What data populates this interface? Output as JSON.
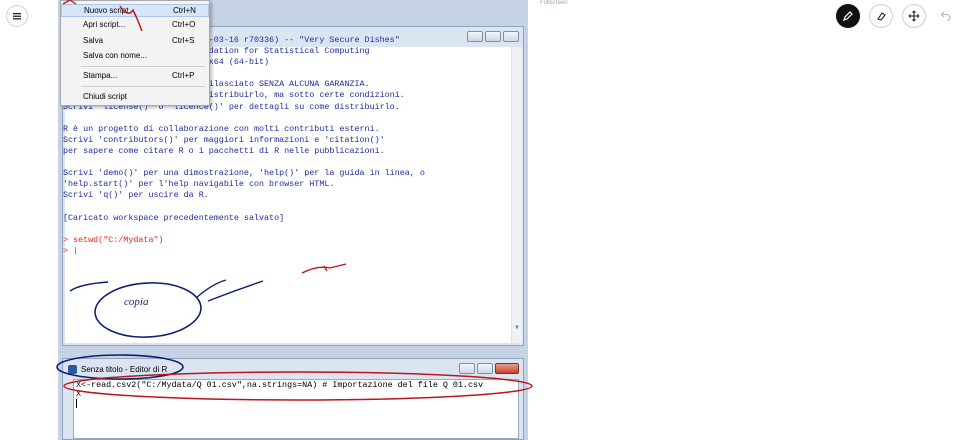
{
  "toolbar": {
    "menu_icon": "hamburger-icon",
    "tools": [
      "pen-icon",
      "eraser-icon",
      "move-icon",
      "undo-icon"
    ]
  },
  "rgui": {
    "fullscreen_label": "Fullscreen",
    "file_menu": [
      {
        "label": "Nuovo script",
        "shortcut": "Ctrl+N"
      },
      {
        "label": "Apri script...",
        "shortcut": "Ctrl+O"
      },
      {
        "label": "Salva",
        "shortcut": "Ctrl+S"
      },
      {
        "label": "Salva con nome...",
        "shortcut": ""
      },
      {
        "label": "Stampa...",
        "shortcut": "Ctrl+P"
      },
      {
        "label": "Chiudi script",
        "shortcut": ""
      }
    ],
    "console": {
      "lines": [
        "                          016-03-16 r70336) -- \"Very Secure Dishes\"",
        "                          oundation for Statistical Computing",
        "                          32/x64 (64-bit)",
        "",
        "R è un software libero ed è rilasciato SENZA ALCUNA GARANZIA.",
        "Siamo ben lieti se potrai redistribuirlo, ma sotto certe condizioni.",
        "Scrivi 'license()' o 'licence()' per dettagli su come distribuirlo.",
        "",
        "R è un progetto di collaborazione con molti contributi esterni.",
        "Scrivi 'contributors()' per maggiori informazioni e 'citation()'",
        "per sapere come citare R o i pacchetti di R nelle pubblicazioni.",
        "",
        "Scrivi 'demo()' per una dimostrazione, 'help()' per la guida in linea, o",
        "'help.start()' per l'help navigabile con browser HTML.",
        "Scrivi 'q()' per uscire da R.",
        "",
        "[Caricato workspace precedentemente salvato]",
        ""
      ],
      "command": "> setwd(\"C:/Mydata\")",
      "prompt": "> |"
    },
    "editor": {
      "title": "Senza titolo - Editor di R",
      "line1": "X<-read.csv2(\"C:/Mydata/Q 01.csv\",na.strings=NA) # Importazione del file Q 01.csv",
      "line2": "X"
    }
  },
  "annotation": {
    "handwritten_text": "copia"
  }
}
